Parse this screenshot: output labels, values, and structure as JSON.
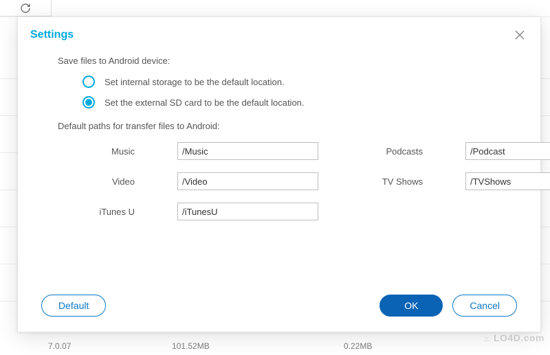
{
  "modal": {
    "title": "Settings",
    "section_label": "Save files to Android device:",
    "options": [
      {
        "label": "Set internal storage to be the default location.",
        "selected": false
      },
      {
        "label": "Set the external SD card to be the default location.",
        "selected": true
      }
    ],
    "paths_label": "Default paths for transfer files to Android:",
    "fields": {
      "music": {
        "label": "Music",
        "value": "/Music"
      },
      "video": {
        "label": "Video",
        "value": "/Video"
      },
      "itunesu": {
        "label": "iTunes U",
        "value": "/iTunesU"
      },
      "podcasts": {
        "label": "Podcasts",
        "value": "/Podcast"
      },
      "tvshows": {
        "label": "TV Shows",
        "value": "/TVShows"
      }
    },
    "buttons": {
      "default": "Default",
      "ok": "OK",
      "cancel": "Cancel"
    }
  },
  "background": {
    "col1": "7.0.07",
    "col2": "101.52MB",
    "col3": "0.22MB"
  },
  "watermark": "LO4D.com"
}
